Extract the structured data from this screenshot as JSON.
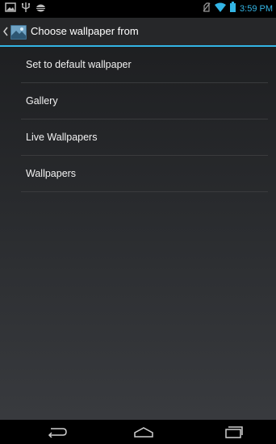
{
  "status_bar": {
    "time": "3:59 PM",
    "left_icons": [
      "screenshot-icon",
      "usb-icon",
      "android-debug-icon"
    ],
    "right_icons": [
      "no-sim-icon",
      "wifi-icon",
      "battery-icon"
    ],
    "accent_color": "#33b5e5"
  },
  "action_bar": {
    "title": "Choose wallpaper from",
    "icon": "wallpaper-app-icon",
    "accent_color": "#33b5e5"
  },
  "options": [
    {
      "label": "Set to default wallpaper"
    },
    {
      "label": "Gallery"
    },
    {
      "label": "Live Wallpapers"
    },
    {
      "label": "Wallpapers"
    }
  ],
  "nav_bar": {
    "buttons": [
      "back-icon",
      "home-icon",
      "recents-icon"
    ]
  }
}
